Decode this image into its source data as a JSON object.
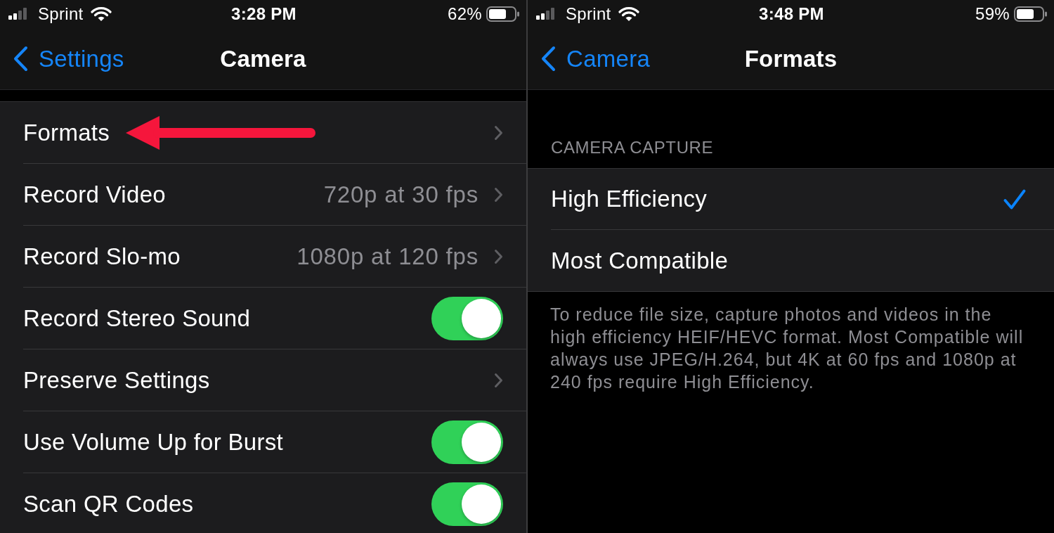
{
  "screens": [
    {
      "kind": "settings_list",
      "status_bar": {
        "carrier": "Sprint",
        "time": "3:28 PM",
        "battery": "62%"
      },
      "nav_bar": {
        "back": "Settings",
        "title": "Camera"
      },
      "rows": [
        {
          "kind": "disclosure",
          "label": "Formats",
          "annotation": {
            "kind": "arrow"
          }
        },
        {
          "kind": "disclosure",
          "label": "Record Video",
          "value": "720p at 30 fps"
        },
        {
          "kind": "disclosure",
          "label": "Record Slo-mo",
          "value": "1080p at 120 fps"
        },
        {
          "kind": "toggle",
          "label": "Record Stereo Sound",
          "on": true
        },
        {
          "kind": "disclosure",
          "label": "Preserve Settings"
        },
        {
          "kind": "toggle",
          "label": "Use Volume Up for Burst",
          "on": true
        },
        {
          "kind": "toggle",
          "label": "Scan QR Codes",
          "on": true
        }
      ]
    },
    {
      "kind": "option_list",
      "status_bar": {
        "carrier": "Sprint",
        "time": "3:48 PM",
        "battery": "59%"
      },
      "nav_bar": {
        "back": "Camera",
        "title": "Formats"
      },
      "section_header": "CAMERA CAPTURE",
      "options": [
        {
          "label": "High Efficiency",
          "selected": true
        },
        {
          "label": "Most Compatible",
          "selected": false
        }
      ],
      "footer": "To reduce file size, capture photos and videos in the high efficiency HEIF/HEVC format. Most Compatible will always use JPEG/H.264, but 4K at 60 fps and 1080p at 240 fps require High Efficiency."
    }
  ]
}
